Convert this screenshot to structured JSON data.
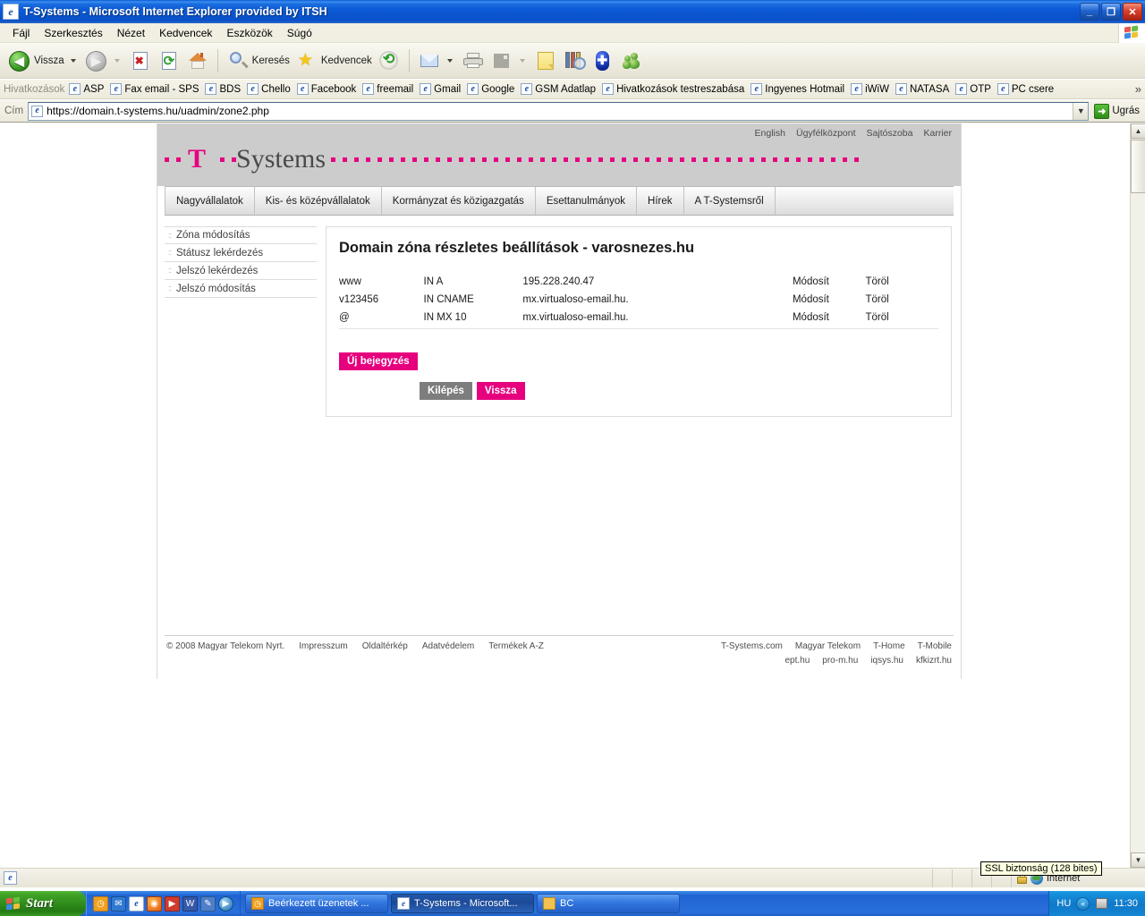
{
  "window": {
    "title": "T-Systems - Microsoft Internet Explorer provided by ITSH",
    "icon": "ie-icon",
    "minimize_label": "_",
    "restore_label": "❐",
    "close_label": "✕"
  },
  "menubar": {
    "items": [
      {
        "label": "Fájl"
      },
      {
        "label": "Szerkesztés"
      },
      {
        "label": "Nézet"
      },
      {
        "label": "Kedvencek"
      },
      {
        "label": "Eszközök"
      },
      {
        "label": "Súgó"
      }
    ]
  },
  "toolbar": {
    "back_label": "Vissza",
    "forward_label": "",
    "search_label": "Keresés",
    "favorites_label": "Kedvencek",
    "icons": [
      "back-arrow-icon",
      "forward-arrow-icon",
      "stop-icon",
      "refresh-icon",
      "home-icon",
      "search-icon",
      "favorites-star-icon",
      "history-icon",
      "mail-icon",
      "print-icon",
      "edit-icon",
      "notes-icon",
      "research-icon",
      "bluetooth-icon",
      "messenger-icon"
    ]
  },
  "linksbar": {
    "label": "Hivatkozások",
    "items": [
      {
        "label": "ASP"
      },
      {
        "label": "Fax email - SPS"
      },
      {
        "label": "BDS"
      },
      {
        "label": "Chello"
      },
      {
        "label": "Facebook"
      },
      {
        "label": "freemail"
      },
      {
        "label": "Gmail"
      },
      {
        "label": "Google"
      },
      {
        "label": "GSM Adatlap"
      },
      {
        "label": "Hivatkozások testreszabása"
      },
      {
        "label": "Ingyenes Hotmail"
      },
      {
        "label": "iWiW"
      },
      {
        "label": "NATASA"
      },
      {
        "label": "OTP"
      },
      {
        "label": "PC csere"
      }
    ],
    "overflow": "»"
  },
  "addressbar": {
    "label": "Cím",
    "url": "https://domain.t-systems.hu/uadmin/zone2.php",
    "dropdown_glyph": "▼",
    "go_label": "Ugrás",
    "go_glyph": "➜"
  },
  "site": {
    "utilnav": [
      {
        "label": "English"
      },
      {
        "label": "Ügyfélközpont"
      },
      {
        "label": "Sajtószoba"
      },
      {
        "label": "Karrier"
      }
    ],
    "logo": {
      "t": "T",
      "word": "Systems",
      "accent_color": "#e6007e"
    },
    "nav": [
      {
        "label": "Nagyvállalatok"
      },
      {
        "label": "Kis- és középvállalatok"
      },
      {
        "label": "Kormányzat és közigazgatás"
      },
      {
        "label": "Esettanulmányok"
      },
      {
        "label": "Hírek"
      },
      {
        "label": "A T-Systemsről"
      }
    ],
    "sidebar": [
      {
        "label": "Zóna módosítás"
      },
      {
        "label": "Státusz lekérdezés"
      },
      {
        "label": "Jelszó lekérdezés"
      },
      {
        "label": "Jelszó módosítás"
      }
    ],
    "content": {
      "heading": "Domain zóna részletes beállítások - varosnezes.hu",
      "rows": [
        {
          "name": "www",
          "type": "IN A",
          "value": "195.228.240.47",
          "edit": "Módosít",
          "delete": "Töröl"
        },
        {
          "name": "v123456",
          "type": "IN CNAME",
          "value": "mx.virtualoso-email.hu.",
          "edit": "Módosít",
          "delete": "Töröl"
        },
        {
          "name": "@",
          "type": "IN MX 10",
          "value": "mx.virtualoso-email.hu.",
          "edit": "Módosít",
          "delete": "Töröl"
        }
      ],
      "new_entry_label": "Új bejegyzés",
      "exit_label": "Kilépés",
      "back_label": "Vissza"
    },
    "footer": {
      "copyright": "© 2008 Magyar Telekom Nyrt.",
      "links": [
        {
          "label": "Impresszum"
        },
        {
          "label": "Oldaltérkép"
        },
        {
          "label": "Adatvédelem"
        },
        {
          "label": "Termékek A-Z"
        }
      ],
      "brands_row1": [
        {
          "label": "T-Systems.com"
        },
        {
          "label": "Magyar Telekom"
        },
        {
          "label": "T-Home"
        },
        {
          "label": "T-Mobile"
        }
      ],
      "brands_row2": [
        {
          "label": "ept.hu"
        },
        {
          "label": "pro-m.hu"
        },
        {
          "label": "iqsys.hu"
        },
        {
          "label": "kfkizrt.hu"
        }
      ]
    }
  },
  "statusbar": {
    "zone_label": "Internet",
    "tooltip": "SSL biztonság (128 bites)"
  },
  "taskbar": {
    "start_label": "Start",
    "quicklaunch": [
      "clock-icon",
      "outlook-icon",
      "ie-icon",
      "firefox-icon",
      "media-icon",
      "word-icon",
      "tools-icon",
      "player-icon"
    ],
    "tasks": [
      {
        "label": "Beérkezett üzenetek ...",
        "icon": "outlook-icon",
        "active": false
      },
      {
        "label": "T-Systems - Microsoft...",
        "icon": "ie-icon",
        "active": true
      },
      {
        "label": "BC",
        "icon": "folder-icon",
        "active": false
      }
    ],
    "tray": {
      "language": "HU",
      "clock": "11:30",
      "chevron": "«",
      "icons": [
        "network-icon"
      ]
    }
  },
  "scrollbar": {
    "up_glyph": "▲",
    "down_glyph": "▼"
  }
}
